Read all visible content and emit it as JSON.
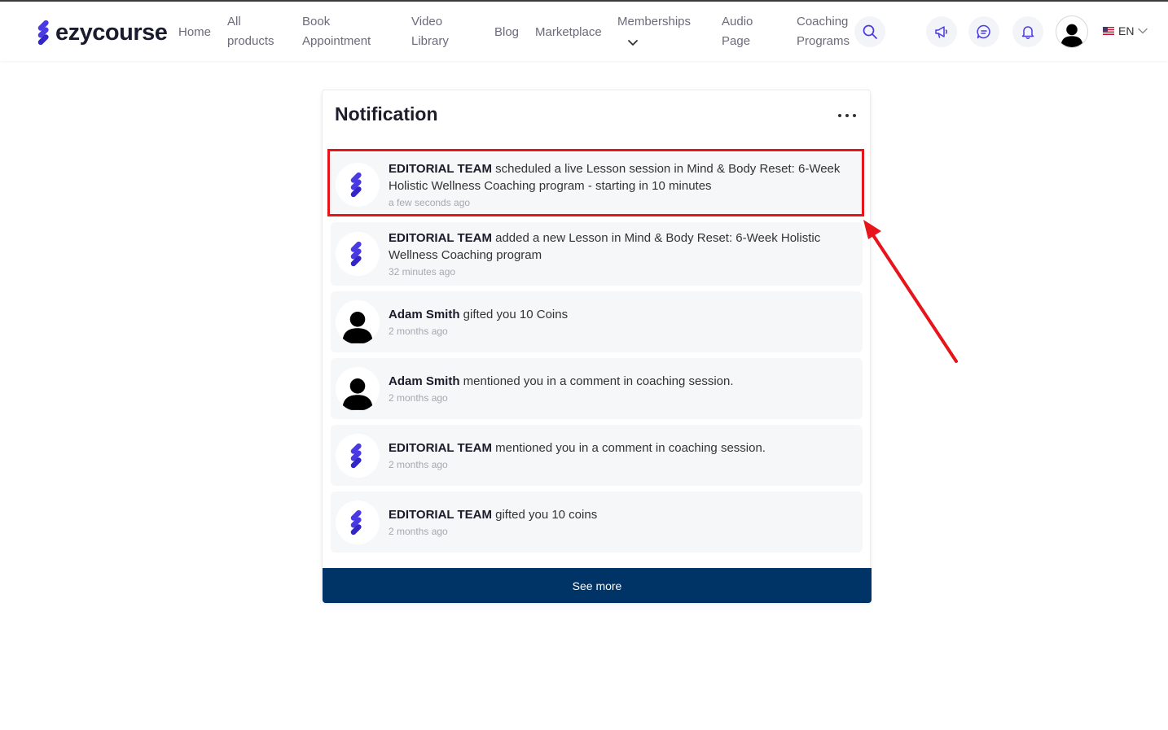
{
  "header": {
    "logo_text": "ezycourse",
    "nav": [
      {
        "line1": "Home",
        "line2": ""
      },
      {
        "line1": "All",
        "line2": "products"
      },
      {
        "line1": "Book",
        "line2": "Appointment"
      },
      {
        "line1": "Video",
        "line2": "Library"
      },
      {
        "line1": "Blog",
        "line2": ""
      },
      {
        "line1": "Marketplace",
        "line2": ""
      },
      {
        "line1": "Memberships",
        "line2": ""
      },
      {
        "line1": "Audio",
        "line2": "Page"
      },
      {
        "line1": "Coaching",
        "line2": "Programs"
      }
    ],
    "icons": [
      "search-icon",
      "megaphone-icon",
      "chat-icon",
      "bell-icon",
      "user-avatar"
    ],
    "language": "EN"
  },
  "card": {
    "title": "Notification",
    "notifications": [
      {
        "actor": "EDITORIAL TEAM",
        "message": " scheduled a live Lesson session in Mind & Body Reset: 6-Week Holistic Wellness Coaching program - starting in 10 minutes",
        "time": "a few seconds ago",
        "avatar": "ezycourse-logo"
      },
      {
        "actor": "EDITORIAL TEAM",
        "message": " added a new Lesson in Mind & Body Reset: 6-Week Holistic Wellness Coaching program",
        "time": "32 minutes ago",
        "avatar": "ezycourse-logo"
      },
      {
        "actor": "Adam Smith",
        "message": " gifted you 10 Coins",
        "time": "2 months ago",
        "avatar": "user-silhouette"
      },
      {
        "actor": "Adam Smith",
        "message": " mentioned you in a comment in coaching session.",
        "time": "2 months ago",
        "avatar": "user-silhouette"
      },
      {
        "actor": "EDITORIAL TEAM",
        "message": " mentioned you in a comment in coaching session.",
        "time": "2 months ago",
        "avatar": "ezycourse-logo"
      },
      {
        "actor": "EDITORIAL TEAM",
        "message": " gifted you 10 coins",
        "time": "2 months ago",
        "avatar": "ezycourse-logo"
      }
    ],
    "see_more_label": "See more"
  },
  "colors": {
    "brand": "#4334dd",
    "button": "#003366",
    "highlight": "#e8141c"
  }
}
